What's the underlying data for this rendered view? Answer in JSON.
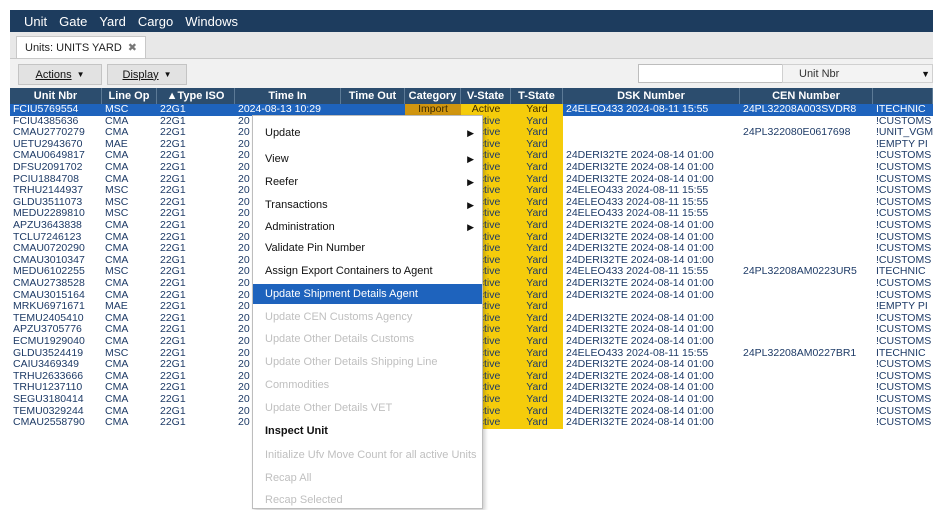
{
  "menubar": {
    "items": [
      "Unit",
      "Gate",
      "Yard",
      "Cargo",
      "Windows"
    ]
  },
  "tab": {
    "label": "Units: UNITS YARD",
    "close": "✖"
  },
  "toolbar": {
    "actions_label": "Actions",
    "display_label": "Display",
    "search_value": "",
    "select_value": "Unit Nbr"
  },
  "columns": [
    "Unit Nbr",
    "Line Op",
    "▲Type ISO",
    "Time In",
    "Time Out",
    "Category",
    "V-State",
    "T-State",
    "DSK Number",
    "CEN Number",
    ""
  ],
  "rows": [
    {
      "unit": "FCIU5769554",
      "op": "MSC",
      "iso": "22G1",
      "tin": "2024-08-13 10:29",
      "tout": "",
      "cat": "Import",
      "vs": "Active",
      "ts": "Yard",
      "dsk": "24ELEO433 2024-08-11 15:55",
      "cen": "24PL32208A003SVDR8",
      "last": "ITECHNIC"
    },
    {
      "unit": "FCIU4385636",
      "op": "CMA",
      "iso": "22G1",
      "tin": "20",
      "tout": "",
      "cat": "",
      "vs": "Active",
      "ts": "Yard",
      "dsk": "",
      "cen": "",
      "last": "!CUSTOMS"
    },
    {
      "unit": "CMAU2770279",
      "op": "CMA",
      "iso": "22G1",
      "tin": "20",
      "tout": "",
      "cat": "",
      "vs": "Active",
      "ts": "Yard",
      "dsk": "",
      "cen": "24PL322080E0617698",
      "last": "!UNIT_VGM"
    },
    {
      "unit": "UETU2943670",
      "op": "MAE",
      "iso": "22G1",
      "tin": "20",
      "tout": "",
      "cat": "",
      "vs": "Active",
      "ts": "Yard",
      "dsk": "",
      "cen": "",
      "last": "!EMPTY PI"
    },
    {
      "unit": "CMAU0649817",
      "op": "CMA",
      "iso": "22G1",
      "tin": "20",
      "tout": "",
      "cat": "",
      "vs": "Active",
      "ts": "Yard",
      "dsk": "24DERI32TE 2024-08-14 01:00",
      "cen": "",
      "last": "!CUSTOMS"
    },
    {
      "unit": "DFSU2091702",
      "op": "CMA",
      "iso": "22G1",
      "tin": "20",
      "tout": "",
      "cat": "",
      "vs": "Active",
      "ts": "Yard",
      "dsk": "24DERI32TE 2024-08-14 01:00",
      "cen": "",
      "last": "!CUSTOMS"
    },
    {
      "unit": "PCIU1884708",
      "op": "CMA",
      "iso": "22G1",
      "tin": "20",
      "tout": "",
      "cat": "",
      "vs": "Active",
      "ts": "Yard",
      "dsk": "24DERI32TE 2024-08-14 01:00",
      "cen": "",
      "last": "!CUSTOMS"
    },
    {
      "unit": "TRHU2144937",
      "op": "MSC",
      "iso": "22G1",
      "tin": "20",
      "tout": "",
      "cat": "",
      "vs": "Active",
      "ts": "Yard",
      "dsk": "24ELEO433 2024-08-11 15:55",
      "cen": "",
      "last": "!CUSTOMS"
    },
    {
      "unit": "GLDU3511073",
      "op": "MSC",
      "iso": "22G1",
      "tin": "20",
      "tout": "",
      "cat": "",
      "vs": "Active",
      "ts": "Yard",
      "dsk": "24ELEO433 2024-08-11 15:55",
      "cen": "",
      "last": "!CUSTOMS"
    },
    {
      "unit": "MEDU2289810",
      "op": "MSC",
      "iso": "22G1",
      "tin": "20",
      "tout": "",
      "cat": "",
      "vs": "Active",
      "ts": "Yard",
      "dsk": "24ELEO433 2024-08-11 15:55",
      "cen": "",
      "last": "!CUSTOMS"
    },
    {
      "unit": "APZU3643838",
      "op": "CMA",
      "iso": "22G1",
      "tin": "20",
      "tout": "",
      "cat": "",
      "vs": "Active",
      "ts": "Yard",
      "dsk": "24DERI32TE 2024-08-14 01:00",
      "cen": "",
      "last": "!CUSTOMS"
    },
    {
      "unit": "TCLU7246123",
      "op": "CMA",
      "iso": "22G1",
      "tin": "20",
      "tout": "",
      "cat": "",
      "vs": "Active",
      "ts": "Yard",
      "dsk": "24DERI32TE 2024-08-14 01:00",
      "cen": "",
      "last": "!CUSTOMS"
    },
    {
      "unit": "CMAU0720290",
      "op": "CMA",
      "iso": "22G1",
      "tin": "20",
      "tout": "",
      "cat": "",
      "vs": "Active",
      "ts": "Yard",
      "dsk": "24DERI32TE 2024-08-14 01:00",
      "cen": "",
      "last": "!CUSTOMS"
    },
    {
      "unit": "CMAU3010347",
      "op": "CMA",
      "iso": "22G1",
      "tin": "20",
      "tout": "",
      "cat": "",
      "vs": "Active",
      "ts": "Yard",
      "dsk": "24DERI32TE 2024-08-14 01:00",
      "cen": "",
      "last": "!CUSTOMS"
    },
    {
      "unit": "MEDU6102255",
      "op": "MSC",
      "iso": "22G1",
      "tin": "20",
      "tout": "",
      "cat": "",
      "vs": "Active",
      "ts": "Yard",
      "dsk": "24ELEO433 2024-08-11 15:55",
      "cen": "24PL32208AM0223UR5",
      "last": "ITECHNIC"
    },
    {
      "unit": "CMAU2738528",
      "op": "CMA",
      "iso": "22G1",
      "tin": "20",
      "tout": "",
      "cat": "",
      "vs": "Active",
      "ts": "Yard",
      "dsk": "24DERI32TE 2024-08-14 01:00",
      "cen": "",
      "last": "!CUSTOMS"
    },
    {
      "unit": "CMAU3015164",
      "op": "CMA",
      "iso": "22G1",
      "tin": "20",
      "tout": "",
      "cat": "",
      "vs": "Active",
      "ts": "Yard",
      "dsk": "24DERI32TE 2024-08-14 01:00",
      "cen": "",
      "last": "!CUSTOMS"
    },
    {
      "unit": "MRKU6971671",
      "op": "MAE",
      "iso": "22G1",
      "tin": "20",
      "tout": "",
      "cat": "",
      "vs": "Active",
      "ts": "Yard",
      "dsk": "",
      "cen": "",
      "last": "!EMPTY PI"
    },
    {
      "unit": "TEMU2405410",
      "op": "CMA",
      "iso": "22G1",
      "tin": "20",
      "tout": "",
      "cat": "",
      "vs": "Active",
      "ts": "Yard",
      "dsk": "24DERI32TE 2024-08-14 01:00",
      "cen": "",
      "last": "!CUSTOMS"
    },
    {
      "unit": "APZU3705776",
      "op": "CMA",
      "iso": "22G1",
      "tin": "20",
      "tout": "",
      "cat": "",
      "vs": "Active",
      "ts": "Yard",
      "dsk": "24DERI32TE 2024-08-14 01:00",
      "cen": "",
      "last": "!CUSTOMS"
    },
    {
      "unit": "ECMU1929040",
      "op": "CMA",
      "iso": "22G1",
      "tin": "20",
      "tout": "",
      "cat": "",
      "vs": "Active",
      "ts": "Yard",
      "dsk": "24DERI32TE 2024-08-14 01:00",
      "cen": "",
      "last": "!CUSTOMS"
    },
    {
      "unit": "GLDU3524419",
      "op": "MSC",
      "iso": "22G1",
      "tin": "20",
      "tout": "",
      "cat": "",
      "vs": "Active",
      "ts": "Yard",
      "dsk": "24ELEO433 2024-08-11 15:55",
      "cen": "24PL32208AM0227BR1",
      "last": "ITECHNIC"
    },
    {
      "unit": "CAIU3469349",
      "op": "CMA",
      "iso": "22G1",
      "tin": "20",
      "tout": "",
      "cat": "",
      "vs": "Active",
      "ts": "Yard",
      "dsk": "24DERI32TE 2024-08-14 01:00",
      "cen": "",
      "last": "!CUSTOMS"
    },
    {
      "unit": "TRHU2633666",
      "op": "CMA",
      "iso": "22G1",
      "tin": "20",
      "tout": "",
      "cat": "",
      "vs": "Active",
      "ts": "Yard",
      "dsk": "24DERI32TE 2024-08-14 01:00",
      "cen": "",
      "last": "!CUSTOMS"
    },
    {
      "unit": "TRHU1237110",
      "op": "CMA",
      "iso": "22G1",
      "tin": "20",
      "tout": "",
      "cat": "",
      "vs": "Active",
      "ts": "Yard",
      "dsk": "24DERI32TE 2024-08-14 01:00",
      "cen": "",
      "last": "!CUSTOMS"
    },
    {
      "unit": "SEGU3180414",
      "op": "CMA",
      "iso": "22G1",
      "tin": "20",
      "tout": "",
      "cat": "",
      "vs": "Active",
      "ts": "Yard",
      "dsk": "24DERI32TE 2024-08-14 01:00",
      "cen": "",
      "last": "!CUSTOMS"
    },
    {
      "unit": "TEMU0329244",
      "op": "CMA",
      "iso": "22G1",
      "tin": "20",
      "tout": "",
      "cat": "",
      "vs": "Active",
      "ts": "Yard",
      "dsk": "24DERI32TE 2024-08-14 01:00",
      "cen": "",
      "last": "!CUSTOMS"
    },
    {
      "unit": "CMAU2558790",
      "op": "CMA",
      "iso": "22G1",
      "tin": "20",
      "tout": "",
      "cat": "",
      "vs": "Active",
      "ts": "Yard",
      "dsk": "24DERI32TE 2024-08-14 01:00",
      "cen": "",
      "last": "!CUSTOMS"
    }
  ],
  "context_menu": {
    "items": [
      {
        "label": "Update",
        "submenu": true,
        "enabled": true
      },
      {
        "label": "View",
        "submenu": true,
        "enabled": true
      },
      {
        "label": "Reefer",
        "submenu": true,
        "enabled": true
      },
      {
        "label": "Transactions",
        "submenu": true,
        "enabled": true
      },
      {
        "label": "Administration",
        "submenu": true,
        "enabled": true
      },
      {
        "label": "Validate Pin Number",
        "submenu": false,
        "enabled": true
      },
      {
        "label": "Assign Export Containers to Agent",
        "submenu": false,
        "enabled": true
      },
      {
        "label": "Update Shipment Details Agent",
        "submenu": false,
        "enabled": true,
        "highlighted": true
      },
      {
        "label": "Update CEN Customs Agency",
        "submenu": false,
        "enabled": false
      },
      {
        "label": "Update Other Details Customs",
        "submenu": false,
        "enabled": false
      },
      {
        "label": "Update Other Details Shipping Line",
        "submenu": false,
        "enabled": false
      },
      {
        "label": "Commodities",
        "submenu": false,
        "enabled": false
      },
      {
        "label": "Update Other Details VET",
        "submenu": false,
        "enabled": false
      },
      {
        "label": "Inspect Unit",
        "submenu": false,
        "enabled": true,
        "bold": true
      },
      {
        "label": "Initialize Ufv Move Count for all active Units",
        "submenu": false,
        "enabled": false
      },
      {
        "label": "Recap All",
        "submenu": false,
        "enabled": false
      },
      {
        "label": "Recap Selected",
        "submenu": false,
        "enabled": false
      }
    ]
  },
  "colors": {
    "menubar": "#1d3c5e",
    "header": "#2c4d6e",
    "selection": "#1e63bd",
    "state_yellow": "#f5cc0b",
    "import_orange": "#d0950f"
  }
}
